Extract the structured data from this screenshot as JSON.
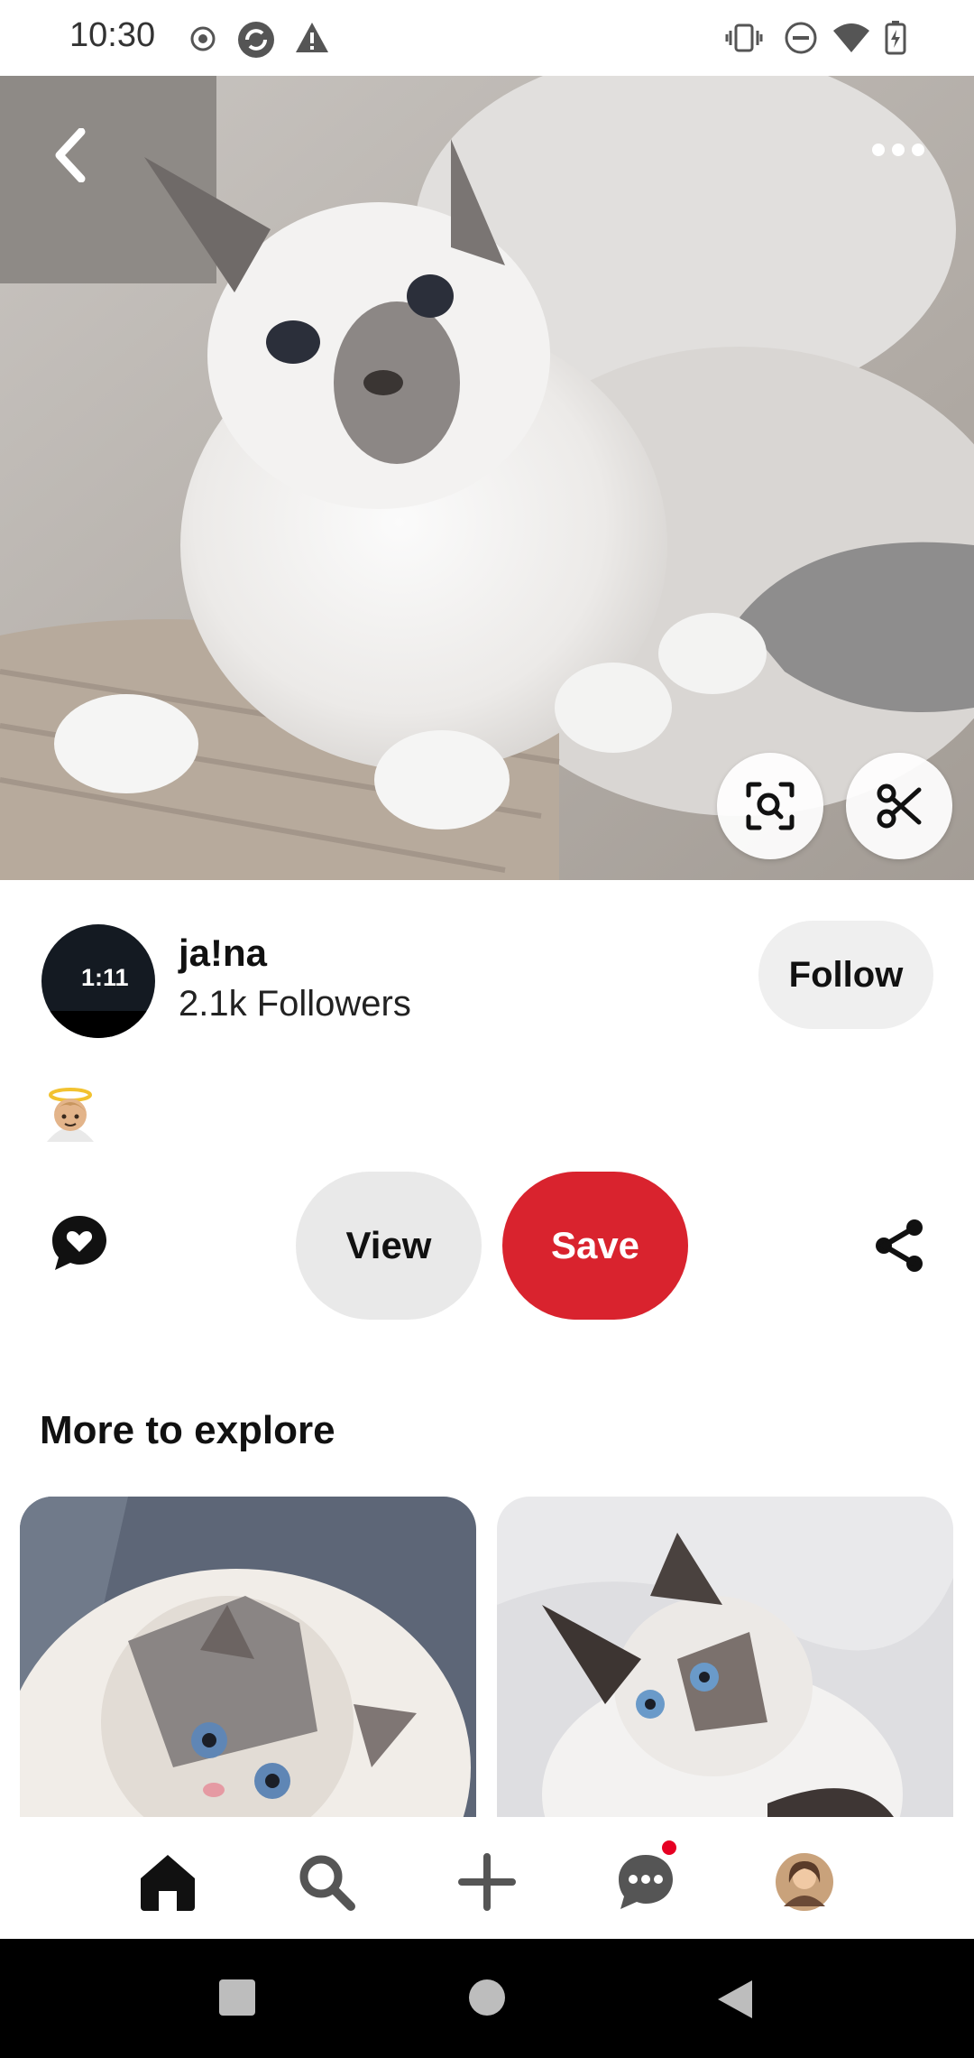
{
  "status_bar": {
    "time": "10:30"
  },
  "pin": {
    "author": {
      "name": "ja!na",
      "followers": "2.1k Followers",
      "avatar_time": "1:11"
    },
    "follow_label": "Follow",
    "emoji": "👼🏼",
    "view_label": "View",
    "save_label": "Save"
  },
  "explore": {
    "title": "More to explore"
  },
  "nav": {
    "items": [
      "home-icon",
      "search-icon",
      "add-icon",
      "messages-icon",
      "profile-avatar"
    ],
    "messages_badge": true
  },
  "colors": {
    "accent": "#d9232e",
    "pill_grey": "#e9e9e9",
    "follow_grey": "#efefef"
  }
}
